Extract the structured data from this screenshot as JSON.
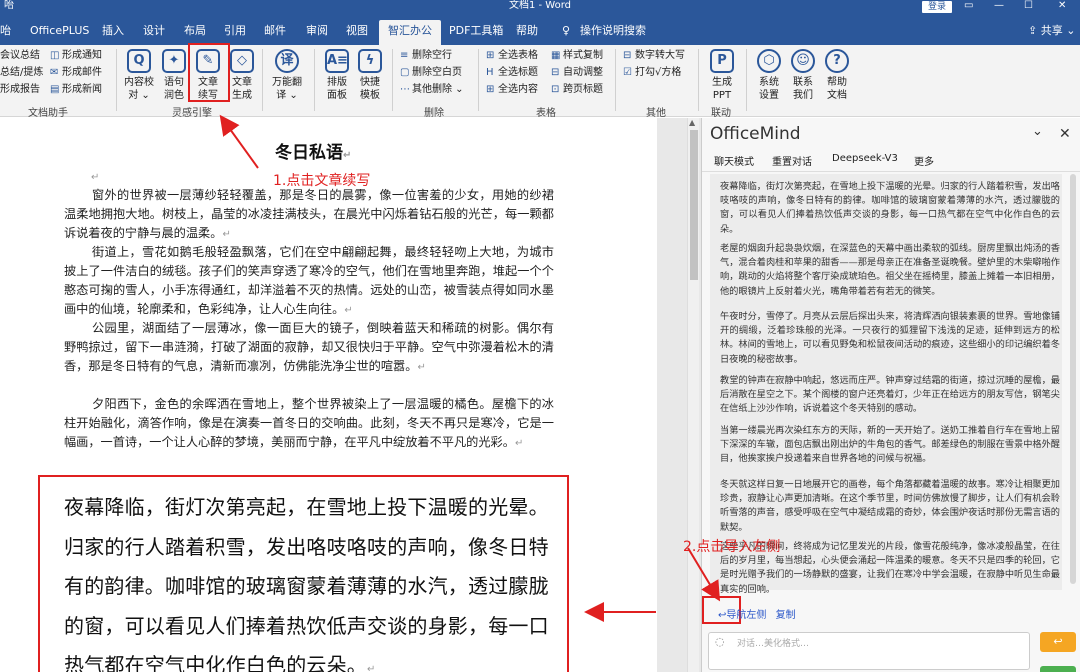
{
  "titlebar": {
    "left": "咍",
    "title": "文档1 - Word",
    "login": "登录",
    "controls": [
      "▭",
      "—",
      "☐",
      "✕"
    ]
  },
  "tabs": [
    {
      "label": "咍"
    },
    {
      "label": "OfficePLUS"
    },
    {
      "label": "插入"
    },
    {
      "label": "设计"
    },
    {
      "label": "布局"
    },
    {
      "label": "引用"
    },
    {
      "label": "邮件"
    },
    {
      "label": "审阅"
    },
    {
      "label": "视图"
    },
    {
      "label": "智汇办公"
    },
    {
      "label": "PDF工具箱"
    },
    {
      "label": "帮助"
    },
    {
      "label": "操作说明搜索"
    }
  ],
  "share": "共享",
  "ribbon": {
    "doc_helper": {
      "items": [
        "会议总结",
        "总结/提炼",
        "形成报告",
        "形成通知",
        "形成邮件",
        "形成新闻"
      ],
      "label": "文档助手"
    },
    "inspiration": {
      "buttons": [
        {
          "line1": "内容校",
          "line2": "对 ⌄",
          "icon": "Q"
        },
        {
          "line1": "语句",
          "line2": "润色",
          "icon": "✦"
        },
        {
          "line1": "文章",
          "line2": "续写",
          "icon": "✎"
        },
        {
          "line1": "文章",
          "line2": "生成",
          "icon": "◇"
        },
        {
          "line1": "万能翻",
          "line2": "译 ⌄",
          "icon": "译"
        },
        {
          "line1": "排版",
          "line2": "面板",
          "icon": "A≡"
        },
        {
          "line1": "快捷",
          "line2": "模板",
          "icon": "ϟ"
        }
      ],
      "label": "灵感引擎"
    },
    "delete": {
      "items": [
        "删除空行",
        "删除空白页",
        "其他删除 ⌄"
      ],
      "label": "删除"
    },
    "table": {
      "items": [
        "全选表格",
        "全选标题",
        "全选内容",
        "样式复制",
        "自动调整",
        "跨页标题"
      ],
      "label": "表格"
    },
    "other": {
      "items": [
        "数字转大写",
        "打勾√方格"
      ],
      "label": "其他"
    },
    "link": {
      "button": {
        "line1": "生成",
        "line2": "PPT"
      },
      "label": "联动"
    },
    "misc": [
      {
        "line1": "系统",
        "line2": "设置"
      },
      {
        "line1": "联系",
        "line2": "我们"
      },
      {
        "line1": "帮助",
        "line2": "文档"
      }
    ]
  },
  "document": {
    "title": "冬日私语",
    "paragraphs": [
      "窗外的世界被一层薄纱轻轻覆盖，那是冬日的晨雾，像一位害羞的少女，用她的纱裙温柔地拥抱大地。树枝上，晶莹的冰凌挂满枝头，在晨光中闪烁着钻石般的光芒，每一颗都诉说着夜的宁静与晨的温柔。",
      "街道上，雪花如鹅毛般轻盈飘落，它们在空中翩翩起舞，最终轻轻吻上大地，为城市披上了一件洁白的绒毯。孩子们的笑声穿透了寒冷的空气，他们在雪地里奔跑，堆起一个个憨态可掬的雪人，小手冻得通红，却洋溢着不灭的热情。远处的山峦，被雪装点得如同水墨画中的仙境，轮廓柔和，色彩纯净，让人心生向往。",
      "公园里，湖面结了一层薄冰，像一面巨大的镜子，倒映着蓝天和稀疏的树影。偶尔有野鸭掠过，留下一串涟漪，打破了湖面的寂静，却又很快归于平静。空气中弥漫着松木的清香，那是冬日特有的气息，清新而凛冽，仿佛能洗净尘世的喧嚣。",
      "夕阳西下，金色的余晖洒在雪地上，整个世界被染上了一层温暖的橘色。屋檐下的冰柱开始融化，滴答作响，像是在演奏一首冬日的交响曲。此刻，冬天不再只是寒冷，它是一幅画，一首诗，一个让人心醉的梦境，美丽而宁静，在平凡中绽放着不平凡的光彩。"
    ],
    "big_paragraph": "夜幕降临，街灯次第亮起，在雪地上投下温暖的光晕。归家的行人踏着积雪，发出咯吱咯吱的声响，像冬日特有的韵律。咖啡馆的玻璃窗蒙着薄薄的水汽，透过朦胧的窗，可以看见人们捧着热饮低声交谈的身影，每一口热气都在空气中化作白色的云朵。",
    "return_mark": "↵"
  },
  "annotations": {
    "step1": "1.点击文章续写",
    "step2": "2.点击导入左侧"
  },
  "panel": {
    "title": "OfficeMind",
    "menu": [
      "聊天模式",
      "重置对话",
      "Deepseek-V3",
      "更多"
    ],
    "paragraphs": [
      "夜幕降临，街灯次第亮起，在雪地上投下温暖的光晕。归家的行人踏着积雪，发出咯吱咯吱的声响，像冬日特有的韵律。咖啡馆的玻璃窗蒙着薄薄的水汽，透过朦胧的窗，可以看见人们捧着热饮低声交谈的身影，每一口热气都在空气中化作白色的云朵。",
      "老屋的烟囱升起袅袅炊烟，在深蓝色的天幕中画出柔软的弧线。厨房里飘出炖汤的香气，混合着肉桂和苹果的甜香——那是母亲正在准备圣诞晚餐。壁炉里的木柴噼啪作响，跳动的火焰将整个客厅染成琥珀色。祖父坐在摇椅里，膝盖上摊着一本旧相册，他的眼镜片上反射着火光，嘴角带着若有若无的微笑。",
      "午夜时分，雪停了。月亮从云层后探出头来，将清辉洒向银装素裹的世界。雪地像铺开的绸缎，泛着珍珠般的光泽。一只夜行的狐狸留下浅浅的足迹，延伸到远方的松林。林间的雪地上，可以看见野兔和松鼠夜间活动的痕迹，这些细小的印记编织着冬日夜晚的秘密故事。",
      "教堂的钟声在寂静中响起，悠远而庄严。钟声穿过结霜的街道，掠过沉睡的屋檐，最后消散在星空之下。某个阁楼的窗户还亮着灯，少年正在给远方的朋友写信，钢笔尖在信纸上沙沙作响，诉说着这个冬天特别的感动。",
      "当第一缕晨光再次染红东方的天际，新的一天开始了。送奶工推着自行车在雪地上留下深深的车辙，面包店飘出刚出炉的牛角包的香气。邮差绿色的制服在雪景中格外醒目，他挨家挨户投递着来自世界各地的问候与祝福。",
      "冬天就这样日复一日地展开它的画卷，每个角落都藏着温暖的故事。寒冷让相聚更加珍贵，寂静让心声更加清晰。在这个季节里，时间仿佛放慢了脚步，让人们有机会聆听雪落的声音，感受呼吸在空气中凝结成霜的奇妙，体会围炉夜话时那份无需言语的默契。",
      "这些平凡的瞬间，终将成为记忆里发光的片段，像雪花般纯净，像冰凌般晶莹，在往后的岁月里，每当想起，心头便会涌起一阵温柔的暖意。冬天不只是四季的轮回，它是时光赠予我们的一场静默的盛宴，让我们在寒冷中学会温暖，在寂静中听见生命最真实的回响。"
    ],
    "links": [
      "↩导航左侧",
      "复制"
    ],
    "input_placeholder": "对话…美化格式…"
  }
}
